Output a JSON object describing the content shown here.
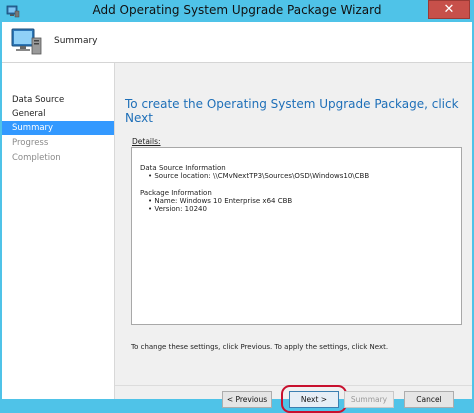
{
  "window": {
    "title": "Add Operating System Upgrade Package Wizard",
    "close_glyph": "✕"
  },
  "header": {
    "title": "Summary"
  },
  "nav": {
    "items": [
      {
        "label": "Data Source",
        "state": "normal"
      },
      {
        "label": "General",
        "state": "normal"
      },
      {
        "label": "Summary",
        "state": "selected"
      },
      {
        "label": "Progress",
        "state": "disabled"
      },
      {
        "label": "Completion",
        "state": "disabled"
      }
    ]
  },
  "content": {
    "heading": "To create the Operating System Upgrade Package, click Next",
    "details_label": "Details:",
    "details": {
      "data_source_heading": "Data Source Information",
      "data_source_location": "• Source location: \\\\CMvNextTP3\\Sources\\OSD\\Windows10\\CBB",
      "package_heading": "Package Information",
      "package_name": "• Name: Windows 10 Enterprise x64 CBB",
      "package_version": "• Version: 10240"
    },
    "hint": "To change these settings, click Previous. To apply the settings, click Next."
  },
  "buttons": {
    "previous": "< Previous",
    "next": "Next >",
    "summary": "Summary",
    "cancel": "Cancel"
  },
  "colors": {
    "title_bar": "#4fc3e8",
    "accent_heading": "#1e6fb8",
    "nav_selected": "#3399ff",
    "highlight_ring": "#c8102e",
    "close_button": "#c7504a"
  }
}
